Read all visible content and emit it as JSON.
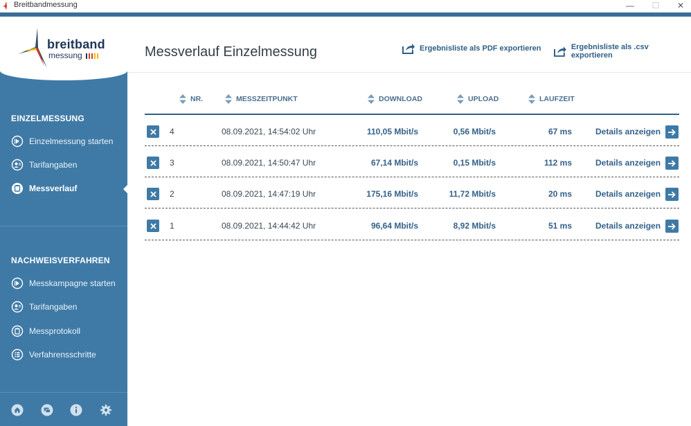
{
  "window": {
    "title": "Breitbandmessung",
    "minimize": "—",
    "maximize": "☐",
    "close": "✕"
  },
  "logo": {
    "line1": "breitband",
    "line2": "messung"
  },
  "sidebar": {
    "section1": "EINZELMESSUNG",
    "section1_items": [
      {
        "label": "Einzelmessung starten",
        "icon": "play-circle-icon"
      },
      {
        "label": "Tarifangaben",
        "icon": "user-tariff-icon"
      },
      {
        "label": "Messverlauf",
        "icon": "history-icon",
        "active": true
      }
    ],
    "section2": "NACHWEISVERFAHREN",
    "section2_items": [
      {
        "label": "Messkampagne starten",
        "icon": "play-circle-icon"
      },
      {
        "label": "Tarifangaben",
        "icon": "user-tariff-icon"
      },
      {
        "label": "Messprotokoll",
        "icon": "clipboard-icon"
      },
      {
        "label": "Verfahrensschritte",
        "icon": "list-icon"
      }
    ],
    "footer_icons": [
      "home-icon",
      "chat-icon",
      "info-icon",
      "settings-icon"
    ]
  },
  "main": {
    "title": "Messverlauf Einzelmessung",
    "export_pdf": "Ergebnisliste als PDF exportieren",
    "export_csv": "Ergebnisliste als .csv exportieren",
    "columns": {
      "nr": "NR.",
      "zeit": "MESSZEITPUNKT",
      "download": "DOWNLOAD",
      "upload": "UPLOAD",
      "laufzeit": "LAUFZEIT"
    },
    "details_label": "Details anzeigen",
    "rows": [
      {
        "nr": "4",
        "zeit": "08.09.2021, 14:54:02 Uhr",
        "download": "110,05 Mbit/s",
        "upload": "0,56 Mbit/s",
        "laufzeit": "67 ms"
      },
      {
        "nr": "3",
        "zeit": "08.09.2021, 14:50:47 Uhr",
        "download": "67,14 Mbit/s",
        "upload": "0,15 Mbit/s",
        "laufzeit": "112 ms"
      },
      {
        "nr": "2",
        "zeit": "08.09.2021, 14:47:19 Uhr",
        "download": "175,16 Mbit/s",
        "upload": "11,72 Mbit/s",
        "laufzeit": "20 ms"
      },
      {
        "nr": "1",
        "zeit": "08.09.2021, 14:44:42 Uhr",
        "download": "96,64 Mbit/s",
        "upload": "8,92 Mbit/s",
        "laufzeit": "51 ms"
      }
    ]
  },
  "colors": {
    "sidebar": "#3f7aa6",
    "accent": "#34618a",
    "topbar": "#3a6e97"
  }
}
